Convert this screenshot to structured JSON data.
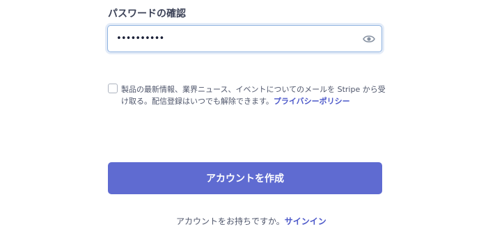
{
  "confirm_password": {
    "label": "パスワードの確認",
    "value": "••••••••••",
    "icon": "eye-icon"
  },
  "consent": {
    "checked": false,
    "text": "製品の最新情報、業界ニュース、イベントについてのメールを Stripe から受け取る。配信登録はいつでも解除できます。",
    "privacy_link": "プライバシーポリシー"
  },
  "submit_label": "アカウントを作成",
  "signin": {
    "prompt": "アカウントをお持ちですか。",
    "link": "サインイン"
  },
  "colors": {
    "accent": "#5f6bd1",
    "link": "#4b57c9",
    "focus_border": "#8fb3e0"
  }
}
